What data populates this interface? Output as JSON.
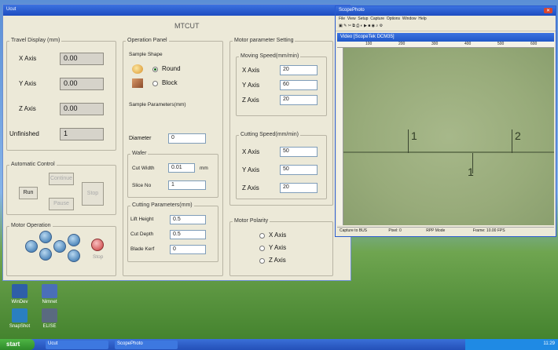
{
  "desktop": {
    "icons": [
      {
        "label": "WinDev",
        "color": "#2e5fa8"
      },
      {
        "label": "Nimnet",
        "color": "#4a6fb8"
      },
      {
        "label": "SnapShot",
        "color": "#2a7fc0"
      },
      {
        "label": "ELISE",
        "color": "#5a6a80"
      }
    ]
  },
  "taskbar": {
    "start_label": "start",
    "tasks": [
      "Ucut",
      "ScopePhoto"
    ],
    "tray_time": "11:29"
  },
  "app": {
    "window_title": "Ucut",
    "title": "MTCUT",
    "travel": {
      "title": "Travel Display (mm)",
      "rows": [
        {
          "label": "X Axis",
          "value": "0.00"
        },
        {
          "label": "Y Axis",
          "value": "0.00"
        },
        {
          "label": "Z Axis",
          "value": "0.00"
        }
      ],
      "unfinished_label": "Unfinished",
      "unfinished_value": "1"
    },
    "auto": {
      "title": "Automatic Control",
      "run": "Run",
      "continue": "Continue",
      "pause": "Pause",
      "stop": "Stop"
    },
    "motor_op": {
      "title": "Motor Operation",
      "stop": "Stop"
    },
    "operation": {
      "title": "Operation Panel",
      "sample_shape": "Sample Shape",
      "round": "Round",
      "block": "Block",
      "sample_params": "Sample Parameters(mm)",
      "diameter_label": "Diameter",
      "diameter_value": "0",
      "wafer": "Wafer",
      "cut_width_label": "Cut Width",
      "cut_width_value": "0.01",
      "cut_width_unit": "mm",
      "slice_no_label": "Slice No",
      "slice_no_value": "1",
      "cutting_params": "Cutting Parameters(mm)",
      "lift_height_label": "Lift Height",
      "lift_height_value": "0.5",
      "cut_depth_label": "Cut Depth",
      "cut_depth_value": "0.5",
      "blade_kerf_label": "Blade Kerf",
      "blade_kerf_value": "0"
    },
    "motor_params": {
      "title": "Motor parameter Setting",
      "moving_title": "Moving Speed(mm/min)",
      "moving": [
        {
          "label": "X Axis",
          "value": "20"
        },
        {
          "label": "Y Axis",
          "value": "60"
        },
        {
          "label": "Z Axis",
          "value": "20"
        }
      ],
      "cutting_title": "Cutting Speed(mm/min)",
      "cutting": [
        {
          "label": "X Axis",
          "value": "50"
        },
        {
          "label": "Y Axis",
          "value": "50"
        },
        {
          "label": "Z Axis",
          "value": "20"
        }
      ],
      "polarity_title": "Motor Polarity",
      "polarity": [
        "X Axis",
        "Y Axis",
        "Z Axis"
      ]
    }
  },
  "viewer": {
    "window_title": "ScopePhoto",
    "menu": [
      "File",
      "View",
      "Setup",
      "Capture",
      "Options",
      "Window",
      "Help"
    ],
    "subwindow_title": "Video [ScopeTek DCM35]",
    "ruler_ticks": [
      "100",
      "200",
      "300",
      "400",
      "500",
      "600"
    ],
    "marks": [
      "1",
      "2",
      "1"
    ],
    "status": [
      "Capture to BUS",
      "Pixel: 0",
      "RPP Mode",
      "Frame: 10.00 FPS"
    ]
  }
}
